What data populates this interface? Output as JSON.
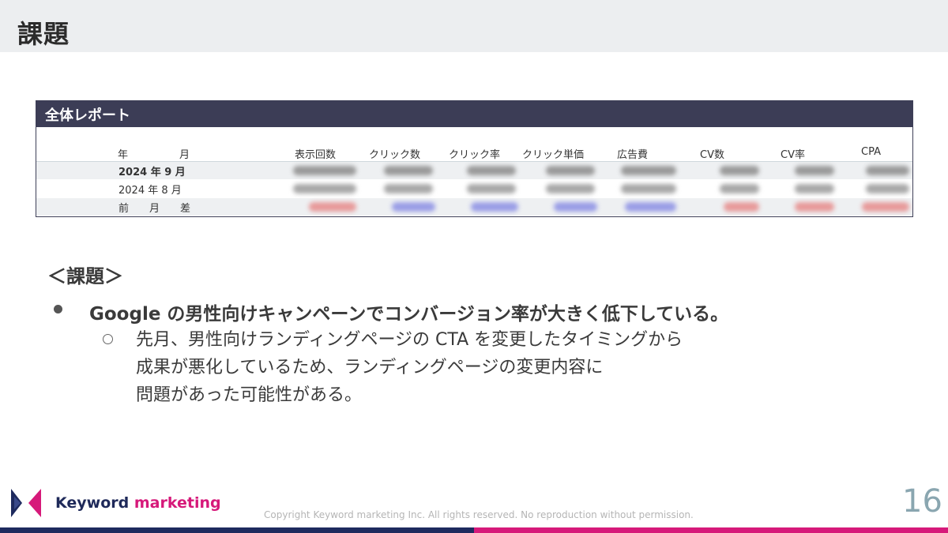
{
  "slide": {
    "title": "課題",
    "page_number": "16"
  },
  "report": {
    "title": "全体レポート",
    "columns": [
      "年　　　　　月",
      "表示回数",
      "クリック数",
      "クリック率",
      "クリック単価",
      "広告費",
      "CV数",
      "CV率",
      "CPA"
    ],
    "rows": [
      {
        "label": "2024 年 9 月",
        "bold": true
      },
      {
        "label": "2024 年 8 月",
        "bold": false
      },
      {
        "label": "前　　月　　差",
        "bold": false
      }
    ],
    "colors": {
      "header_bg": "#3c3d56",
      "blur_gray": "#9a9a9a",
      "blur_red": "#e79a9a",
      "blur_blue": "#9a9ee6"
    }
  },
  "issues": {
    "heading": "＜課題＞",
    "main_point": "Google の男性向けキャンペーンでコンバージョン率が大きく低下している。",
    "sub_point_lines": [
      "先月、男性向けランディングページの CTA を変更したタイミングから",
      "成果が悪化しているため、ランディングページの変更内容に",
      "問題があった可能性がある。"
    ]
  },
  "footer": {
    "brand_part1": "Keyword",
    "brand_part2": "marketing",
    "copyright": "Copyright Keyword marketing Inc. All rights reserved. No reproduction without permission."
  }
}
